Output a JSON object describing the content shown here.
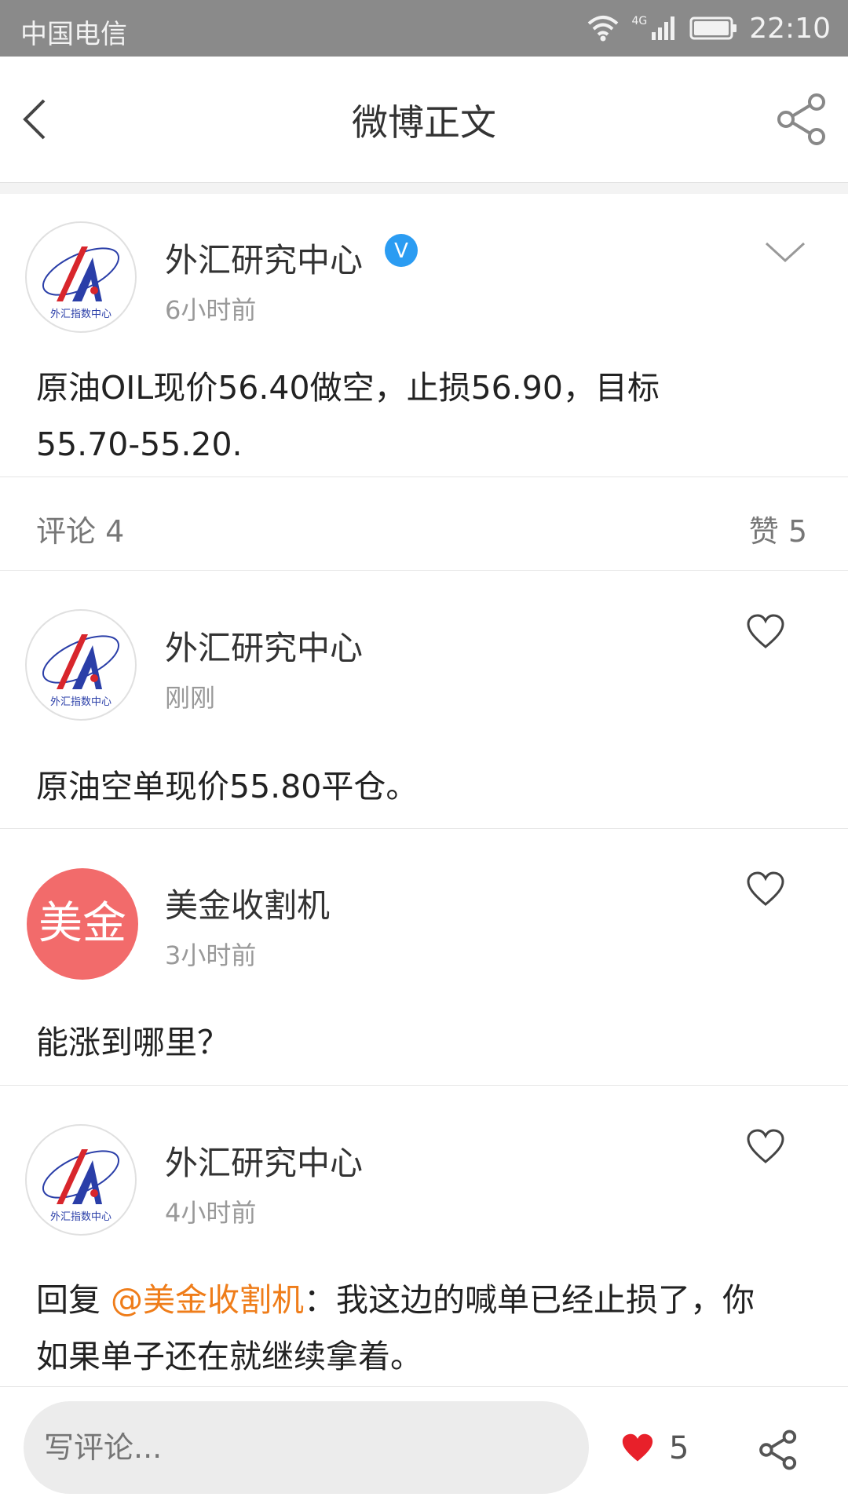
{
  "status_bar": {
    "carrier": "中国电信",
    "network": "4G",
    "time": "22:10"
  },
  "header": {
    "title": "微博正文",
    "back_icon": "chevron-left-icon",
    "share_icon": "share-icon"
  },
  "post": {
    "author": "外汇研究中心",
    "verified_badge": "V",
    "time": "6小时前",
    "text_line1": "原油OIL现价56.40做空，止损56.90，目标",
    "text_line2": "55.70-55.20.",
    "avatar_caption": "外汇指数中心"
  },
  "stats": {
    "comments_label": "评论 4",
    "likes_label": "赞 5"
  },
  "comments": [
    {
      "author": "外汇研究中心",
      "time": "刚刚",
      "text": "原油空单现价55.80平仓。"
    },
    {
      "author": "美金收割机",
      "avatar_text": "美金",
      "time": "3小时前",
      "text": "能涨到哪里？"
    },
    {
      "author": "外汇研究中心",
      "time": "4小时前",
      "text_prefix": "回复 ",
      "mention": "@美金收割机",
      "text_line1_rest": "：我这边的喊单已经止损了，你",
      "text_line2": "如果单子还在就继续拿着。"
    }
  ],
  "bottom_bar": {
    "comment_placeholder": "写评论...",
    "like_count": "5"
  },
  "colors": {
    "accent_orange": "#ef7d1a",
    "like_red": "#e8202a",
    "verified_blue": "#2b9cf2",
    "avatar_red": "#f26b6b"
  }
}
